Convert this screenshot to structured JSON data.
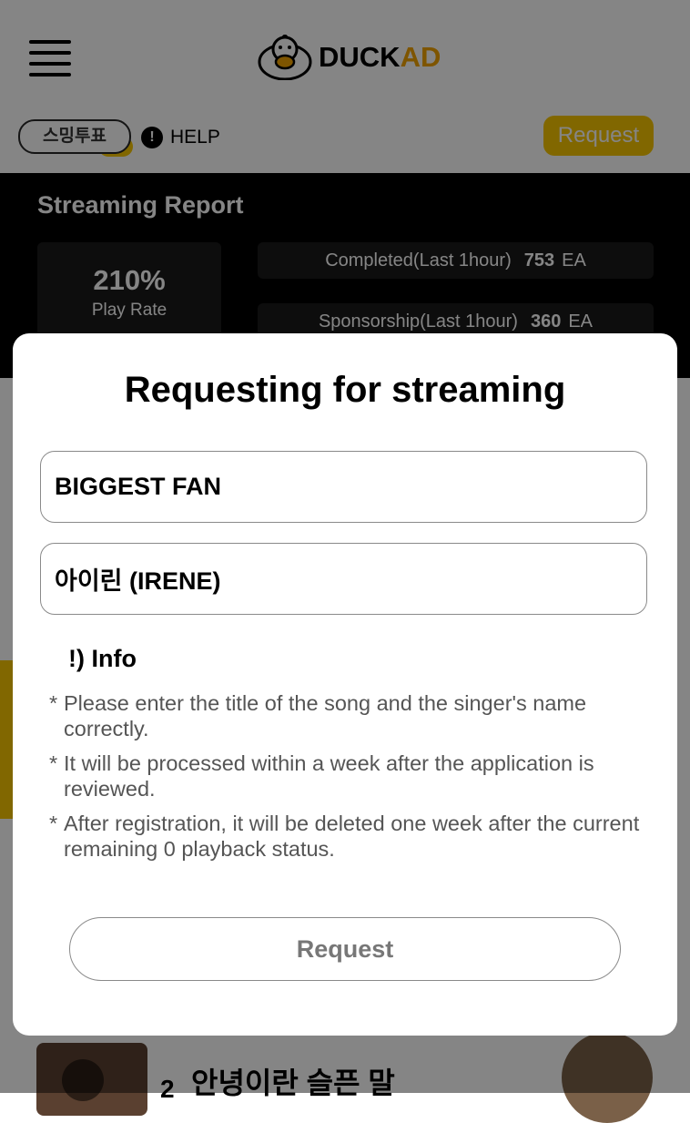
{
  "header": {
    "logo_duck": "DUCK",
    "logo_ad": "AD",
    "vote_label": "스밍투표",
    "help_label": "HELP",
    "request_label": "Request"
  },
  "report": {
    "title": "Streaming Report",
    "rate_value": "210%",
    "rate_label": "Play Rate",
    "completed_label": "Completed(Last 1hour)",
    "completed_value": "753",
    "sponsorship_label": "Sponsorship(Last 1hour)",
    "sponsorship_value": "360",
    "unit": "EA"
  },
  "bottom": {
    "rank": "2",
    "song_title": "안녕이란 슬픈 말"
  },
  "modal": {
    "title": "Requesting for streaming",
    "song_field_value": "BIGGEST FAN",
    "singer_field_value": "아이린 (IRENE)",
    "info_title": "!) Info",
    "info_items": [
      "Please enter the title of the song and the singer's name correctly.",
      "It will be processed within a week after the application is reviewed.",
      "After registration, it will be deleted one week after the current remaining 0 playback status."
    ],
    "submit_label": "Request"
  },
  "colors": {
    "accent": "#f7c600",
    "logo_ad": "#f2a400"
  },
  "icons": {
    "menu": "hamburger-icon",
    "logo": "duck-logo-icon",
    "help": "exclamation-icon"
  }
}
